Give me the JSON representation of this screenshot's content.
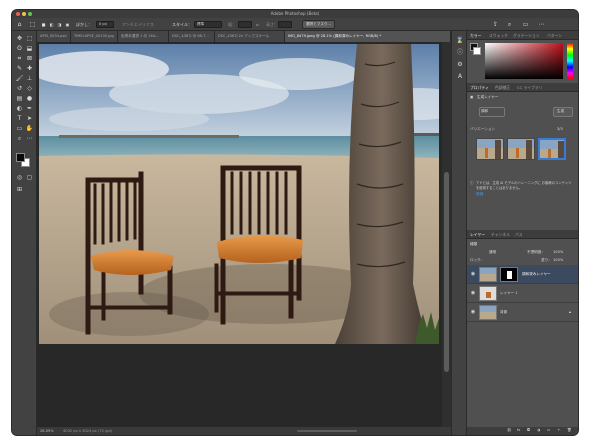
{
  "window": {
    "title": "Adobe Photoshop (Beta)"
  },
  "options_bar": {
    "feather_label": "ぼかし：",
    "feather_value": "0 px",
    "antialias_label": "アンチエイリアス",
    "style_label": "スタイル：",
    "style_value": "標準",
    "width_label": "幅：",
    "height_label": "高さ：",
    "select_mask_button": "選択とマスク..."
  },
  "document_tabs": [
    {
      "label": "APSI_0034.psd"
    },
    {
      "label": "TIMELAPSE_00135.jpg"
    },
    {
      "label": "色帯未選択 1 @ 164..."
    },
    {
      "label": "DSC_4367j @ 66.7..."
    },
    {
      "label": "DSC_4367j 2x アップスケール"
    },
    {
      "label": "IMG_8479.jpeg @ 28.1% (調和済みレイヤー, RGB/8) *"
    }
  ],
  "status_bar": {
    "zoom": "28.09%",
    "doc_info": "4032 px x 3024 px (72 ppi)"
  },
  "color_panel": {
    "tabs": [
      "カラー",
      "スウォッチ",
      "グラデーション",
      "パターン"
    ],
    "swatch_color": "#c0101a"
  },
  "properties_panel": {
    "tabs": [
      "プロパティ",
      "色調補正",
      "CC ライブラリ"
    ],
    "layer_type": "生成レイヤー",
    "harmonize_label": "調和",
    "variations_label": "バリエーション",
    "variations_count": "3/3",
    "disclaimer": "アドビは、生成 AI モデルのトレーニングに お客様のコンテンツを使用することはありません。",
    "learn_more": "詳細",
    "generate_button": "生成"
  },
  "layers_panel": {
    "tabs": [
      "レイヤー",
      "チャンネル",
      "パス"
    ],
    "kind_label": "種類",
    "blend_mode": "通常",
    "opacity_label": "不透明度：",
    "opacity_value": "100%",
    "lock_label": "ロック：",
    "fill_label": "塗り：",
    "fill_value": "100%",
    "layers": [
      {
        "name": "調和済みレイヤー"
      },
      {
        "name": "レイヤー 1"
      },
      {
        "name": "背景"
      }
    ]
  }
}
